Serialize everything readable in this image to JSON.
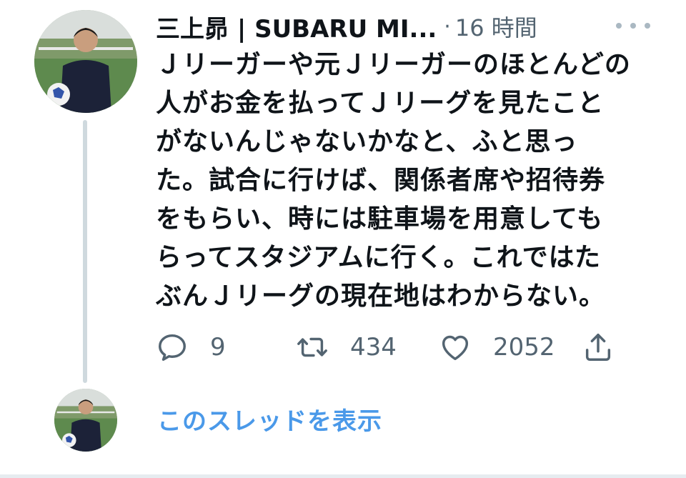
{
  "tweet": {
    "author_name": "三上昴 | SUBARU MI...",
    "separator": "·",
    "time": "16 時間",
    "avatar_icon": "profile-photo",
    "more_icon": "more-horizontal-icon",
    "text_lines": [
      "Ｊリーガーや元Ｊリーガーのほとんどの",
      "人がお金を払ってＪリーグを見たこと",
      "がないんじゃないかなと、ふと思っ",
      "た。試合に行けば、関係者席や招待券",
      "をもらい、時には駐車場を用意しても",
      "らってスタジアムに行く。これではた",
      "ぶんＪリーグの現在地はわからない。"
    ],
    "actions": {
      "reply": {
        "icon": "reply-icon",
        "count": "9"
      },
      "retweet": {
        "icon": "retweet-icon",
        "count": "434"
      },
      "like": {
        "icon": "heart-icon",
        "count": "2052"
      },
      "share": {
        "icon": "share-icon"
      }
    }
  },
  "thread": {
    "show_label": "このスレッドを表示"
  },
  "colors": {
    "text_primary": "#0f1419",
    "text_secondary": "#536471",
    "link_blue": "#4a99e9",
    "thread_line": "#cfd9de"
  }
}
